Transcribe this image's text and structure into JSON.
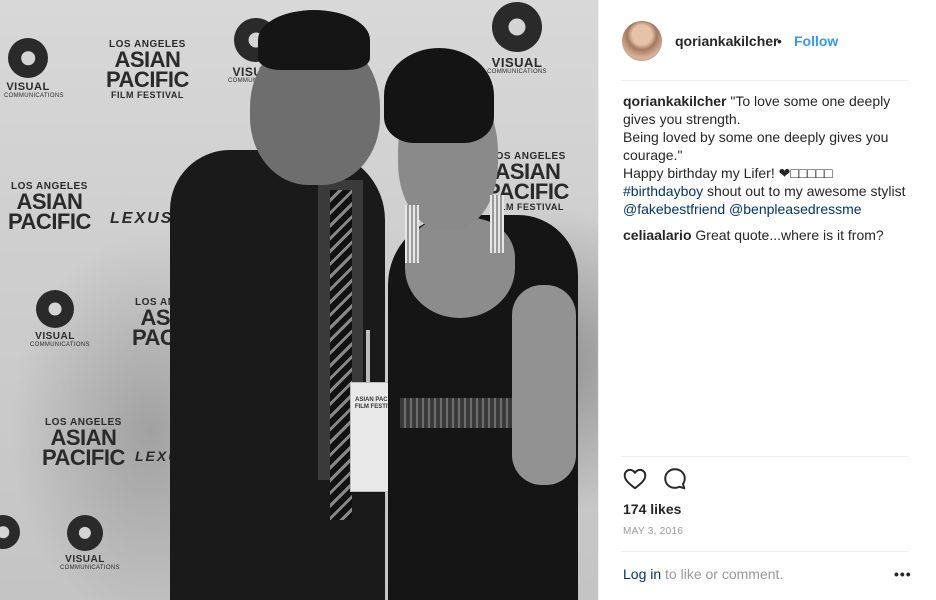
{
  "photo": {
    "backdrop_logos": {
      "visual": "VISUAL",
      "communications": "COMMUNICATIONS",
      "la": "LOS ANGELES",
      "asian": "ASIAN",
      "pacific": "PACIFIC",
      "film_festival": "FILM FESTIVAL",
      "lexus": "LEXUS"
    },
    "badge_text": "ASIAN PACIFIC FILM FESTIVAL"
  },
  "post": {
    "username": "qoriankakilcher",
    "separator": "•",
    "follow_label": "Follow",
    "caption": {
      "username": "qoriankakilcher",
      "line1": "\"To love some one deeply gives you strength.",
      "line2": "Being loved by some one deeply gives you courage.\"",
      "line3": "Happy birthday my Lifer! ❤□□□□□",
      "hashtag": "#birthdayboy",
      "line4_rest": " shout out to my awesome stylist",
      "mention1": "@fakebestfriend",
      "mention2": "@benpleasedressme"
    },
    "comments": [
      {
        "username": "celiaalario",
        "text": "Great quote...where is it from?"
      }
    ],
    "likes": "174 likes",
    "date": "MAY 3, 2016",
    "login_link": "Log in",
    "login_rest": " to like or comment.",
    "more_label": "•••"
  },
  "icons": [
    "heart-icon",
    "comment-icon",
    "more-options-icon"
  ],
  "colors": {
    "link_blue": "#3897f0",
    "link_dark": "#003569",
    "text": "#262626",
    "muted": "#999999"
  }
}
